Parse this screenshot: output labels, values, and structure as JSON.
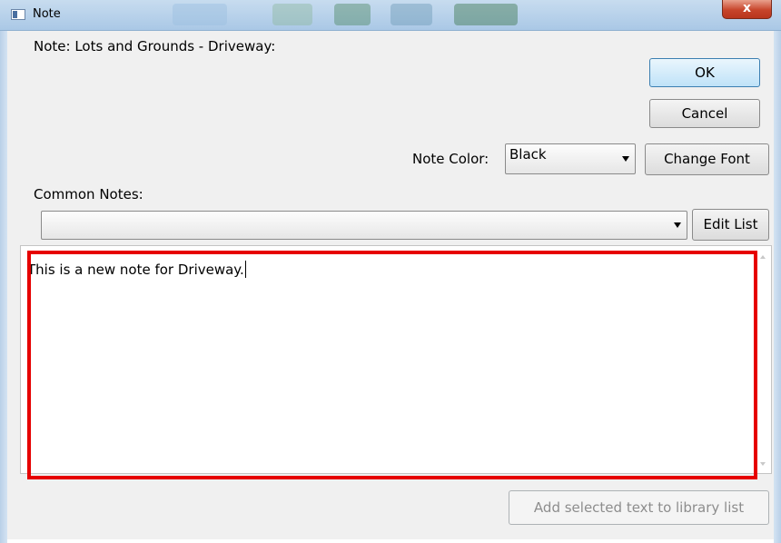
{
  "window": {
    "title": "Note",
    "close_label": "x"
  },
  "note_label": "Note: Lots and Grounds - Driveway:",
  "buttons": {
    "ok": "OK",
    "cancel": "Cancel",
    "change_font": "Change Font",
    "edit_list": "Edit List",
    "add_selected": "Add selected text to library list"
  },
  "note_color": {
    "label": "Note Color:",
    "selected": "Black"
  },
  "common_notes": {
    "label": "Common Notes:",
    "selected": ""
  },
  "note_text": "This is a new note for Driveway.",
  "colors": {
    "highlight": "#e60000",
    "default_button": "#bfe2f8"
  }
}
